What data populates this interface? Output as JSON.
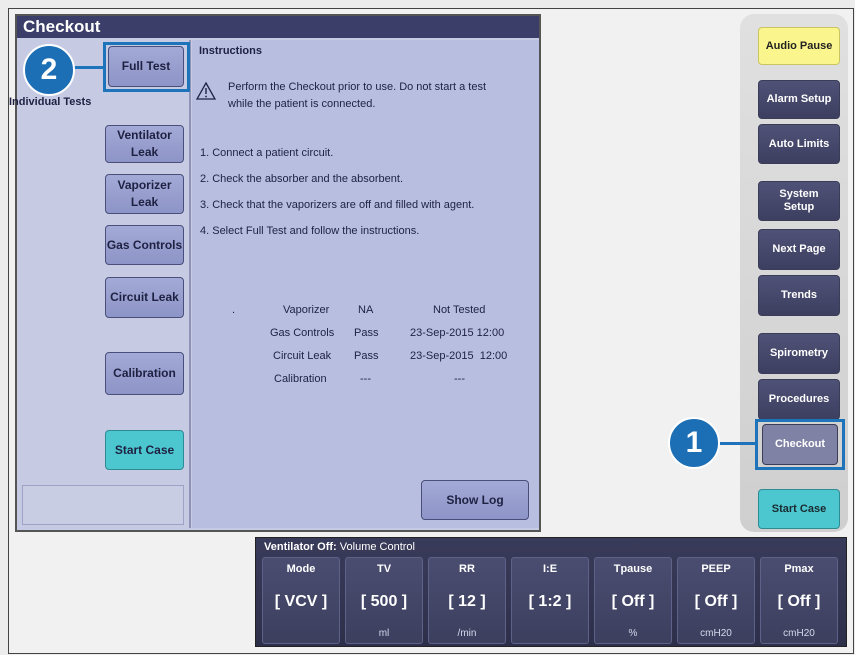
{
  "right_buttons": {
    "audio_pause": "Audio Pause",
    "alarm_setup": "Alarm Setup",
    "auto_limits": "Auto Limits",
    "system_setup_1": "System",
    "system_setup_2": "Setup",
    "next_page": "Next Page",
    "trends": "Trends",
    "spirometry": "Spirometry",
    "procedures": "Procedures",
    "checkout": "Checkout",
    "start_case": "Start Case"
  },
  "callouts": {
    "one": "1",
    "two": "2"
  },
  "window": {
    "title": "Checkout",
    "full_test": "Full Test",
    "individual_tests": "Individual Tests",
    "ventilator_leak_1": "Ventilator",
    "ventilator_leak_2": "Leak",
    "vaporizer_leak_1": "Vaporizer",
    "vaporizer_leak_2": "Leak",
    "gas_controls": "Gas Controls",
    "circuit_leak": "Circuit Leak",
    "calibration": "Calibration",
    "start_case": "Start Case",
    "show_log": "Show Log"
  },
  "instructions": {
    "title": "Instructions",
    "warning_line1": "Perform the Checkout prior to use. Do not start a test",
    "warning_line2": "while the patient is connected.",
    "steps": [
      "1.  Connect a patient circuit.",
      "2.  Check the absorber and the absorbent.",
      "3.  Check that the vaporizers are off and filled with agent.",
      "4.  Select Full Test and follow the instructions."
    ]
  },
  "results": {
    "dot": ".",
    "rows": [
      {
        "name": "Vaporizer",
        "status": "NA",
        "time": "Not Tested"
      },
      {
        "name": "Gas Controls",
        "status": "Pass",
        "time": "23-Sep-2015 12:00"
      },
      {
        "name": "Circuit Leak",
        "status": "Pass",
        "time": "23-Sep-2015  12:00"
      },
      {
        "name": "Calibration",
        "status": "---",
        "time": "---"
      }
    ]
  },
  "ventilator": {
    "status_bold": "Ventilator Off:",
    "mode_text": " Volume Control",
    "params": [
      {
        "label": "Mode",
        "value": "[ VCV ]",
        "unit": ""
      },
      {
        "label": "TV",
        "value": "[ 500 ]",
        "unit": "ml"
      },
      {
        "label": "RR",
        "value": "[ 12 ]",
        "unit": "/min"
      },
      {
        "label": "I:E",
        "value": "[ 1:2 ]",
        "unit": ""
      },
      {
        "label": "Tpause",
        "value": "[ Off ]",
        "unit": "%"
      },
      {
        "label": "PEEP",
        "value": "[ Off ]",
        "unit": "cmH20"
      },
      {
        "label": "Pmax",
        "value": "[ Off ]",
        "unit": "cmH20"
      }
    ]
  }
}
